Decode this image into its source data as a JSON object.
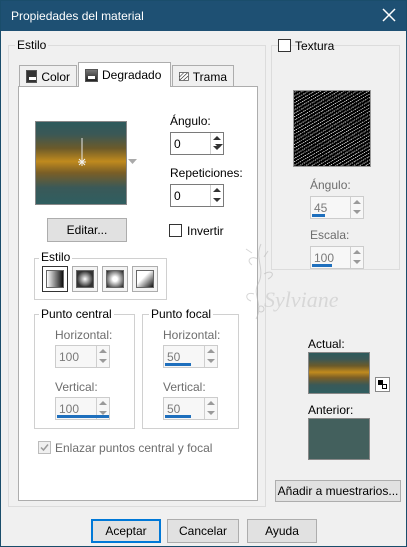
{
  "window": {
    "title": "Propiedades del material"
  },
  "estilo_group": {
    "label": "Estilo"
  },
  "tabs": [
    {
      "label": "Color",
      "active": false
    },
    {
      "label": "Degradado",
      "active": true
    },
    {
      "label": "Trama",
      "active": false
    }
  ],
  "gradient": {
    "angle_label": "Ángulo:",
    "angle_value": "0",
    "repeats_label": "Repeticiones:",
    "repeats_value": "0",
    "edit_button": "Editar...",
    "invert_label": "Invertir",
    "invert_checked": false,
    "style_label": "Estilo",
    "style_buttons": [
      "linear",
      "rectangular",
      "sunburst",
      "radial"
    ],
    "colors": [
      "#2d5a5c",
      "#c08a1e",
      "#2f5e60"
    ]
  },
  "center_point": {
    "label": "Punto central",
    "horizontal_label": "Horizontal:",
    "horizontal_value": "100",
    "vertical_label": "Vertical:",
    "vertical_value": "100"
  },
  "focal_point": {
    "label": "Punto focal",
    "horizontal_label": "Horizontal:",
    "horizontal_value": "50",
    "vertical_label": "Vertical:",
    "vertical_value": "50"
  },
  "link_points": {
    "label": "Enlazar puntos central y focal",
    "checked": true,
    "enabled": false
  },
  "texture": {
    "label": "Textura",
    "checked": false,
    "angle_label": "Ángulo:",
    "angle_value": "45",
    "scale_label": "Escala:",
    "scale_value": "100"
  },
  "watermark": {
    "text": "Sylviane"
  },
  "current": {
    "label": "Actual:"
  },
  "previous": {
    "label": "Anterior:",
    "color": "#43605d"
  },
  "add_swatches_button": "Añadir a muestrarios...",
  "buttons": {
    "ok": "Aceptar",
    "cancel": "Cancelar",
    "help": "Ayuda"
  }
}
